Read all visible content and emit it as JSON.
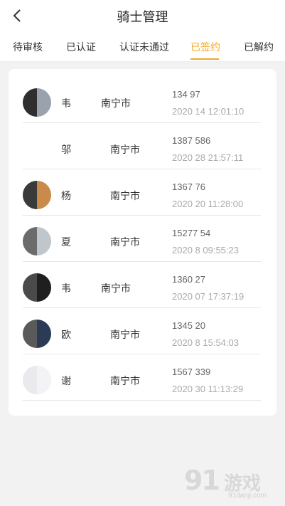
{
  "header": {
    "title": "骑士管理",
    "back_icon": "chevron-left-icon"
  },
  "tabs": [
    {
      "label": "待审核",
      "active": false
    },
    {
      "label": "已认证",
      "active": false
    },
    {
      "label": "认证未通过",
      "active": false
    },
    {
      "label": "已签约",
      "active": true
    },
    {
      "label": "已解约",
      "active": false
    }
  ],
  "accent_color": "#f5a623",
  "riders": [
    {
      "name": "韦",
      "city": "南宁市",
      "phone": "134 97",
      "time": "2020 14 12:01:10"
    },
    {
      "name": "邬",
      "city": "南宁市",
      "phone": "1387 586",
      "time": "2020 28 21:57:11"
    },
    {
      "name": "杨",
      "city": "南宁市",
      "phone": "1367 76",
      "time": "2020 20 11:28:00"
    },
    {
      "name": "夏",
      "city": "南宁市",
      "phone": "15277 54",
      "time": "2020 8 09:55:23"
    },
    {
      "name": "韦",
      "city": "南宁市",
      "phone": "1360 27",
      "time": "2020 07 17:37:19"
    },
    {
      "name": "欧",
      "city": "南宁市",
      "phone": "1345 20",
      "time": "2020 8 15:54:03"
    },
    {
      "name": "谢",
      "city": "南宁市",
      "phone": "1567 339",
      "time": "2020 30 11:13:29"
    }
  ],
  "watermark": {
    "logo": "91",
    "text": "游戏",
    "sub": "91danji.com"
  }
}
